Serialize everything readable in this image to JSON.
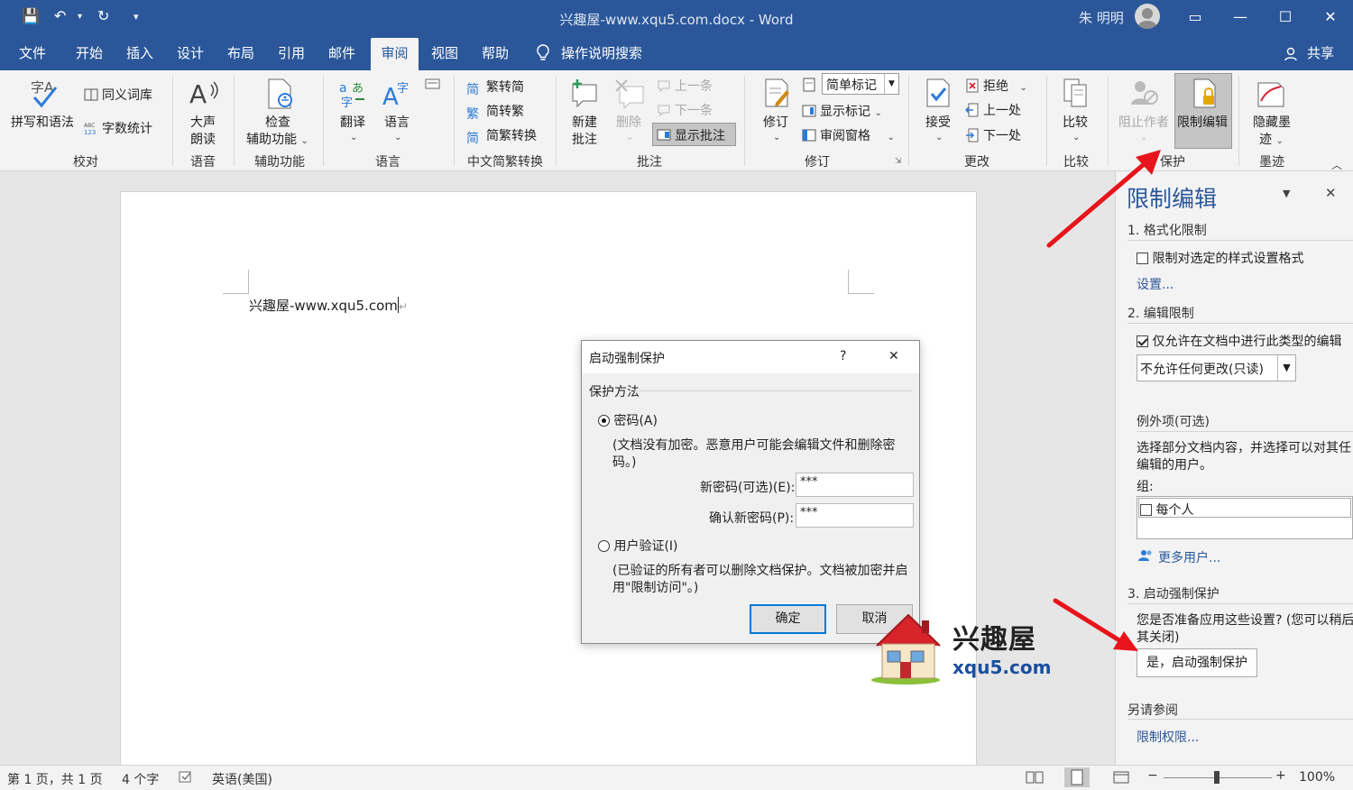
{
  "titlebar": {
    "doc_title": "兴趣屋-www.xqu5.com.docx  -  Word",
    "user_name": "朱 明明",
    "qa_save": "💾",
    "qa_undo": "↶",
    "qa_redo": "↻",
    "qa_more": "▾",
    "ribbon_display": "▭",
    "minimize": "—",
    "maximize": "☐",
    "close": "✕"
  },
  "tabs": [
    {
      "label": "文件"
    },
    {
      "label": "开始"
    },
    {
      "label": "插入"
    },
    {
      "label": "设计"
    },
    {
      "label": "布局"
    },
    {
      "label": "引用"
    },
    {
      "label": "邮件"
    },
    {
      "label": "审阅",
      "active": true
    },
    {
      "label": "视图"
    },
    {
      "label": "帮助"
    }
  ],
  "tell_me": "操作说明搜索",
  "share": "共享",
  "ribbon": {
    "proofing": {
      "spelling": "拼写和语法",
      "thesaurus": "同义词库",
      "wordcount": "字数统计",
      "label": "校对"
    },
    "speech": {
      "read_aloud_1": "大声",
      "read_aloud_2": "朗读",
      "label": "语音"
    },
    "accessibility": {
      "check_1": "检查",
      "check_2": "辅助功能",
      "label": "辅助功能"
    },
    "language": {
      "translate": "翻译",
      "language": "语言",
      "label": "语言"
    },
    "chinese": {
      "t2s": "繁转简",
      "s2t": "简转繁",
      "convert": "简繁转换",
      "label": "中文简繁转换"
    },
    "comments": {
      "new_1": "新建",
      "new_2": "批注",
      "delete": "删除",
      "prev": "上一条",
      "next": "下一条",
      "show": "显示批注",
      "label": "批注"
    },
    "tracking": {
      "track": "修订",
      "markup_select": "简单标记",
      "show_markup": "显示标记",
      "review_pane": "审阅窗格",
      "label": "修订"
    },
    "changes": {
      "accept": "接受",
      "reject": "拒绝",
      "prev": "上一处",
      "next": "下一处",
      "label": "更改"
    },
    "compare": {
      "compare": "比较",
      "label": "比较"
    },
    "protect": {
      "block_authors": "阻止作者",
      "restrict": "限制编辑",
      "label": "保护"
    },
    "ink": {
      "hide_ink_1": "隐藏墨",
      "hide_ink_2": "迹",
      "label": "墨迹"
    }
  },
  "document": {
    "text": "兴趣屋-www.xqu5.com"
  },
  "dialog": {
    "title": "启动强制保护",
    "help": "?",
    "close": "✕",
    "section": "保护方法",
    "password_option": "密码(A)",
    "password_desc_1": "(文档没有加密。恶意用户可能会编辑文件和删除密",
    "password_desc_2": "码。)",
    "new_password_label": "新密码(可选)(E):",
    "new_password_value": "***",
    "confirm_password_label": "确认新密码(P):",
    "confirm_password_value": "***",
    "user_auth_option": "用户验证(I)",
    "user_auth_desc_1": "(已验证的所有者可以删除文档保护。文档被加密并启",
    "user_auth_desc_2": "用\"限制访问\"。)",
    "ok": "确定",
    "cancel": "取消"
  },
  "pane": {
    "title": "限制编辑",
    "section1": "1. 格式化限制",
    "format_check": "限制对选定的样式设置格式",
    "settings_link": "设置...",
    "section2": "2. 编辑限制",
    "edit_check": "仅允许在文档中进行此类型的编辑",
    "edit_select": "不允许任何更改(只读)",
    "exceptions": "例外项(可选)",
    "exceptions_desc_1": "选择部分文档内容，并选择可以对其任",
    "exceptions_desc_2": "编辑的用户。",
    "groups_label": "组:",
    "everyone": "每个人",
    "more_users": "更多用户...",
    "section3": "3. 启动强制保护",
    "ready_q_1": "您是否准备应用这些设置? (您可以稍后",
    "ready_q_2": "其关闭)",
    "start_button": "是，启动强制保护",
    "see_also": "另请参阅",
    "permissions_link": "限制权限..."
  },
  "statusbar": {
    "page": "第 1 页，共 1 页",
    "words": "4 个字",
    "language": "英语(美国)",
    "zoom": "100%",
    "minus": "−",
    "plus": "+"
  },
  "watermark": {
    "cn": "兴趣屋",
    "url": "xqu5.com"
  },
  "colors": {
    "brand": "#2b579a",
    "annotation_arrow": "#e8141b"
  }
}
